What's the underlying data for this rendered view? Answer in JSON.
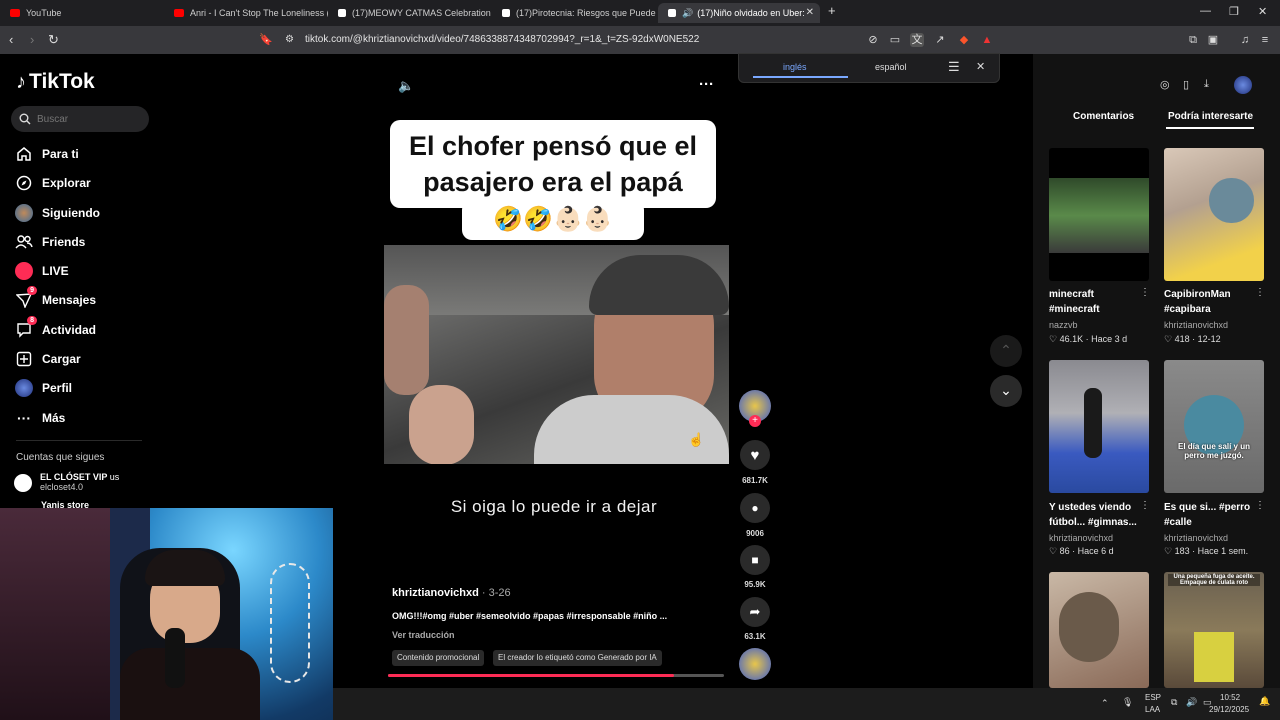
{
  "browser": {
    "tabs": [
      {
        "title": "YouTube",
        "color": "#ff0000"
      },
      {
        "title": "Anri - I Can't Stop The Loneliness (Su",
        "color": "#ff0000"
      },
      {
        "title": "(17)MEOWY CATMAS Celebration | Ti",
        "color": "#ffffff"
      },
      {
        "title": "(17)Pirotecnia: Riesgos que Pueden A",
        "color": "#ffffff"
      },
      {
        "title": "(17)Niño olvidado en Uber: u",
        "color": "#ffffff"
      }
    ],
    "url": "tiktok.com/@khriztianovichxd/video/7486338874348702994?_r=1&_t=ZS-92dxW0NE522"
  },
  "translate_bar": {
    "lang_from": "inglés",
    "lang_to": "español"
  },
  "sidebar": {
    "logo": "TikTok",
    "search_placeholder": "Buscar",
    "items": [
      {
        "label": "Para ti",
        "icon": "home-icon"
      },
      {
        "label": "Explorar",
        "icon": "compass-icon"
      },
      {
        "label": "Siguiendo",
        "icon": "following-avatar-icon"
      },
      {
        "label": "Friends",
        "icon": "friends-icon"
      },
      {
        "label": "LIVE",
        "icon": "live-icon"
      },
      {
        "label": "Mensajes",
        "icon": "messages-icon",
        "badge": "9"
      },
      {
        "label": "Actividad",
        "icon": "activity-icon",
        "badge": "8"
      },
      {
        "label": "Cargar",
        "icon": "upload-icon"
      },
      {
        "label": "Perfil",
        "icon": "profile-icon"
      },
      {
        "label": "Más",
        "icon": "more-icon"
      }
    ],
    "following_title": "Cuentas que sigues",
    "following": [
      {
        "name": "EL CLÓSET VIP",
        "tag": "us",
        "handle": "elcloset4.0"
      },
      {
        "name": "Yanis store"
      }
    ]
  },
  "video": {
    "caption_line1": "El chofer pensó que el",
    "caption_line2": "pasajero era el papá",
    "emojis": "🤣🤣👶🏻👶🏻",
    "subtitle": "Si oiga lo puede ir a dejar",
    "author": "khriztianovichxd",
    "date": " · 3-26",
    "description": "OMG!!!#omg #uber #semeolvido #papas #irresponsable #niño ...",
    "translate_link": "Ver traducción",
    "chips": [
      "Contenido promocional",
      "El creador lo etiquetó como Generado por IA"
    ],
    "progress": 0.85
  },
  "actions": {
    "likes": "681.7K",
    "comments": "9006",
    "saves": "95.9K",
    "shares": "63.1K"
  },
  "right_panel": {
    "tab_comments": "Comentarios",
    "tab_suggested": "Podría interesarte",
    "videos": [
      {
        "title1": "minecraft",
        "title2": "#minecraft",
        "user": "nazzvb",
        "likes": "46.1K",
        "when": "Hace 3 d"
      },
      {
        "title1": "CapibironMan",
        "title2": "#capibara",
        "user": "khriztianovichxd",
        "likes": "418",
        "when": "12-12"
      },
      {
        "title1": "Y ustedes viendo",
        "title2": "fútbol... #gimnas...",
        "user": "khriztianovichxd",
        "likes": "86",
        "when": "Hace 6 d"
      },
      {
        "title1": "Es que si... #perro",
        "title2": "#calle",
        "user": "khriztianovichxd",
        "likes": "183",
        "when": "Hace 1 sem.",
        "overlay": "El día que salí y un perro me juzgó."
      },
      {
        "overlay": ""
      },
      {
        "overlay": "Una pequeña fuga de aceite. Empaque de culata roto"
      }
    ]
  },
  "taskbar": {
    "lang": "ESP",
    "layout": "LAA",
    "time": "10:52",
    "date": "29/12/2025"
  }
}
